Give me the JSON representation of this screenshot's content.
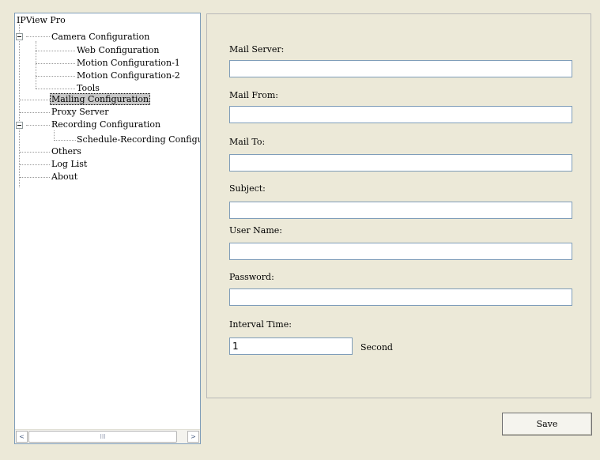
{
  "tree": {
    "root": "IPView Pro",
    "camera_configuration": "Camera Configuration",
    "web_configuration": "Web Configuration",
    "motion_configuration_1": "Motion Configuration-1",
    "motion_configuration_2": "Motion Configuration-2",
    "tools": "Tools",
    "mailing_configuration": "Mailing Configuration",
    "proxy_server": "Proxy Server",
    "recording_configuration": "Recording Configuration",
    "schedule_recording": "Schedule-Recording Configu",
    "others": "Others",
    "log_list": "Log List",
    "about": "About",
    "selected": "Mailing Configuration"
  },
  "scrollbar": {
    "left_arrow": "<",
    "right_arrow": ">",
    "grip": "III"
  },
  "form": {
    "mail_server_label": "Mail Server:",
    "mail_server_value": "",
    "mail_from_label": "Mail From:",
    "mail_from_value": "",
    "mail_to_label": "Mail To:",
    "mail_to_value": "",
    "subject_label": "Subject:",
    "subject_value": "",
    "user_name_label": "User Name:",
    "user_name_value": "",
    "password_label": "Password:",
    "password_value": "",
    "interval_time_label": "Interval Time:",
    "interval_time_value": "1",
    "interval_unit": "Second"
  },
  "save_label": "Save",
  "icons": {
    "expander": "minus-box-icon"
  }
}
